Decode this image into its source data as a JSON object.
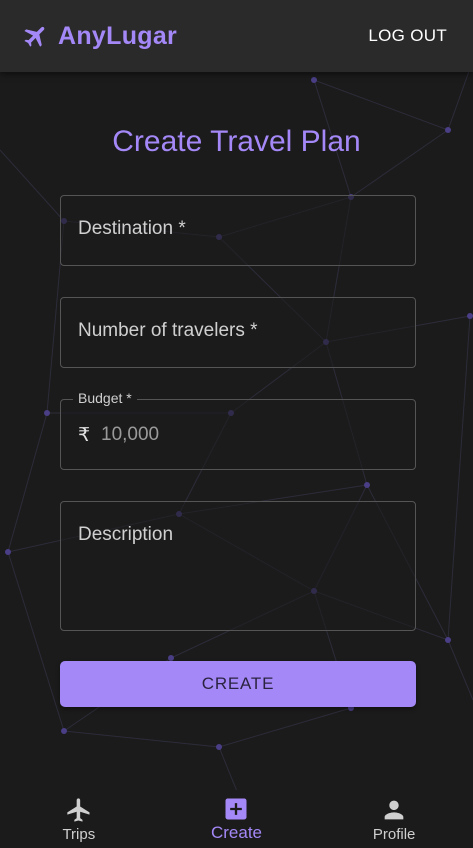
{
  "app": {
    "name": "AnyLugar",
    "brand_icon": "plane-icon"
  },
  "header": {
    "logout_label": "LOG OUT"
  },
  "page": {
    "title": "Create Travel Plan"
  },
  "form": {
    "destination": {
      "placeholder": "Destination *",
      "value": ""
    },
    "travelers": {
      "placeholder": "Number of travelers *",
      "value": ""
    },
    "budget": {
      "label": "Budget *",
      "currency_symbol": "₹",
      "value": "10,000"
    },
    "description": {
      "placeholder": "Description",
      "value": ""
    },
    "submit_label": "CREATE"
  },
  "bottom_nav": {
    "items": [
      {
        "label": "Trips",
        "icon": "plane-icon",
        "active": false
      },
      {
        "label": "Create",
        "icon": "add-box-icon",
        "active": true
      },
      {
        "label": "Profile",
        "icon": "person-icon",
        "active": false
      }
    ]
  },
  "colors": {
    "accent": "#a488f7",
    "background": "#1b1b1b",
    "appbar": "#2a2a2a",
    "network_dots": "#4a3f86"
  }
}
